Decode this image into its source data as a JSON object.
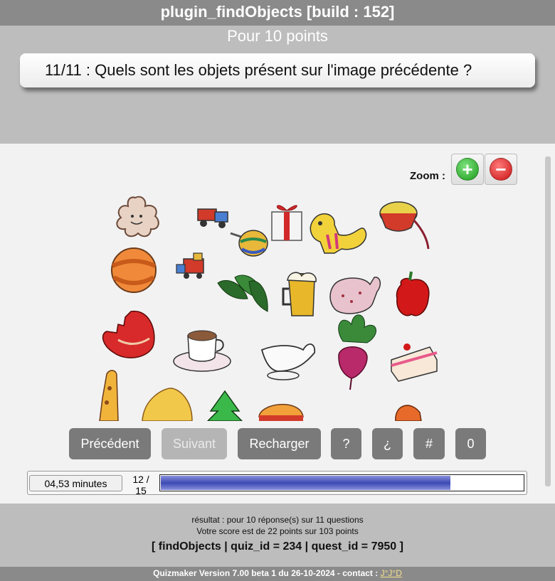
{
  "app": {
    "title": "plugin_findObjects [build : 152]"
  },
  "header": {
    "points": "Pour 10 points",
    "question": "11/11 : Quels sont les objets présent sur l'image précédente ?"
  },
  "zoom": {
    "label": "Zoom :",
    "in_symbol": "+",
    "out_symbol": "−"
  },
  "scene": {
    "objects": [
      "flower-cookie",
      "toy-truck",
      "gift-box",
      "toy-dragon",
      "drum",
      "spinning-top",
      "orange-ball",
      "toy-train",
      "spinach-leaves",
      "beer-mug",
      "oven-mitt",
      "red-pepper",
      "bitten-apple",
      "coffee-cup",
      "gravy-boat",
      "radish",
      "cake-slice",
      "giraffe",
      "croissant",
      "fir-tree",
      "burger",
      "bread"
    ]
  },
  "nav": {
    "prev": "Précédent",
    "next": "Suivant",
    "reload": "Recharger",
    "help": "?",
    "inverted_help": "¿",
    "hash": "#",
    "zero": "0"
  },
  "status": {
    "timer": "04,53 minutes",
    "counter_top": "12 /",
    "counter_bottom": "15",
    "progress": 0.8
  },
  "footer": {
    "result_line1": "résultat : pour 10 réponse(s) sur 11 questions",
    "result_line2": "Votre score est de 22 points sur 103 points",
    "ids": "[ findObjects | quiz_id = 234 | quest_id = 7950 ]"
  },
  "version": {
    "text": "Quizmaker Version 7.00 beta 1 du 26-10-2024 - contact : ",
    "contact": "J°J°D"
  },
  "colors": {
    "title_bg": "#8a8a8a",
    "header_bg": "#bdbdbd",
    "button_bg": "#7a7a7a",
    "progress": "#3c4ab4"
  }
}
